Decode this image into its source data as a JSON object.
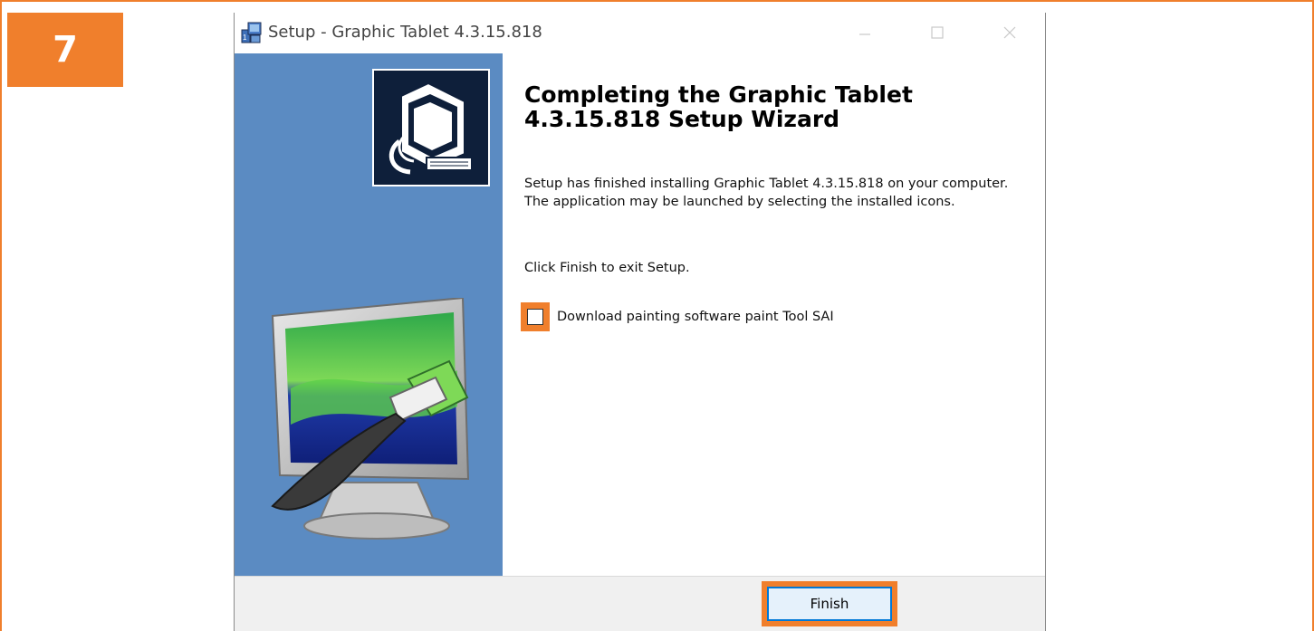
{
  "step_badge": "7",
  "window": {
    "title": "Setup - Graphic Tablet 4.3.15.818",
    "icon": "setup-installer-icon",
    "controls": [
      "minimize-icon",
      "maximize-icon",
      "close-icon"
    ]
  },
  "wizard": {
    "heading": "Completing the Graphic Tablet 4.3.15.818 Setup Wizard",
    "message": "Setup has finished installing Graphic Tablet 4.3.15.818 on your computer. The application may be launched by selecting the installed icons.",
    "exit_hint": "Click Finish to exit Setup.",
    "checkbox": {
      "label": "Download painting software paint Tool SAI",
      "checked": false
    },
    "finish_label": "Finish"
  },
  "colors": {
    "highlight": "#f07f2c",
    "side_panel": "#5b8bc2",
    "focus_border": "#0078d7"
  }
}
